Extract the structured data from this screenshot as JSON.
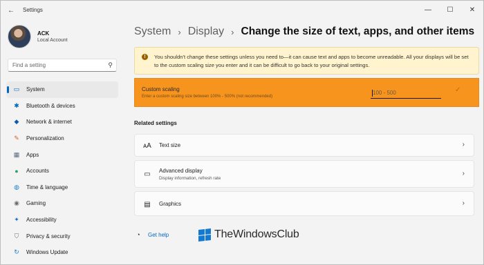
{
  "app": {
    "title": "Settings",
    "back_icon": "back-arrow-icon",
    "controls": {
      "minimize": "—",
      "maximize": "☐",
      "close": "✕"
    }
  },
  "profile": {
    "name": "ACK",
    "account_type": "Local Account"
  },
  "search": {
    "placeholder": "Find a setting",
    "icon": "search-icon"
  },
  "sidebar": {
    "items": [
      {
        "label": "System",
        "icon": "system-icon",
        "glyph": "▭",
        "color": "#0067c0",
        "active": true
      },
      {
        "label": "Bluetooth & devices",
        "icon": "bluetooth-icon",
        "glyph": "✱",
        "color": "#0067c0",
        "active": false
      },
      {
        "label": "Network & internet",
        "icon": "network-icon",
        "glyph": "◆",
        "color": "#0a5da8",
        "active": false
      },
      {
        "label": "Personalization",
        "icon": "brush-icon",
        "glyph": "✎",
        "color": "#d0642a",
        "active": false
      },
      {
        "label": "Apps",
        "icon": "apps-icon",
        "glyph": "▦",
        "color": "#5c6a7c",
        "active": false
      },
      {
        "label": "Accounts",
        "icon": "accounts-icon",
        "glyph": "●",
        "color": "#2e9e6a",
        "active": false
      },
      {
        "label": "Time & language",
        "icon": "globe-clock-icon",
        "glyph": "◍",
        "color": "#1a7fc4",
        "active": false
      },
      {
        "label": "Gaming",
        "icon": "gamepad-icon",
        "glyph": "◉",
        "color": "#6b6b6b",
        "active": false
      },
      {
        "label": "Accessibility",
        "icon": "accessibility-icon",
        "glyph": "✦",
        "color": "#1b6fd0",
        "active": false
      },
      {
        "label": "Privacy & security",
        "icon": "shield-icon",
        "glyph": "⛉",
        "color": "#6b6b6b",
        "active": false
      },
      {
        "label": "Windows Update",
        "icon": "update-icon",
        "glyph": "↻",
        "color": "#1a7fc4",
        "active": false
      }
    ]
  },
  "breadcrumb": {
    "items": [
      "System",
      "Display"
    ],
    "separator": "›",
    "current": "Change the size of text, apps, and other items"
  },
  "warning": {
    "icon": "info-icon",
    "text": "You shouldn't change these settings unless you need to—it can cause text and apps to become unreadable. All your displays will be set to the custom scaling size you enter and it can be difficult to go back to your original settings."
  },
  "custom_scaling": {
    "title": "Custom scaling",
    "description": "Enter a custom scaling size between 100% - 500% (not recommended)",
    "input_placeholder": "100 - 500",
    "input_value": "",
    "check_icon": "checkmark-icon",
    "highlight_color": "#f7941d"
  },
  "related": {
    "heading": "Related settings",
    "cards": [
      {
        "title": "Text size",
        "subtitle": "",
        "icon": "text-size-icon",
        "glyph": "ᴀA"
      },
      {
        "title": "Advanced display",
        "subtitle": "Display information, refresh rate",
        "icon": "monitor-icon",
        "glyph": "▭"
      },
      {
        "title": "Graphics",
        "subtitle": "",
        "icon": "graphics-icon",
        "glyph": "▤"
      }
    ]
  },
  "help": {
    "label": "Get help",
    "icon": "help-icon"
  },
  "watermark": {
    "text": "TheWindowsClub"
  }
}
